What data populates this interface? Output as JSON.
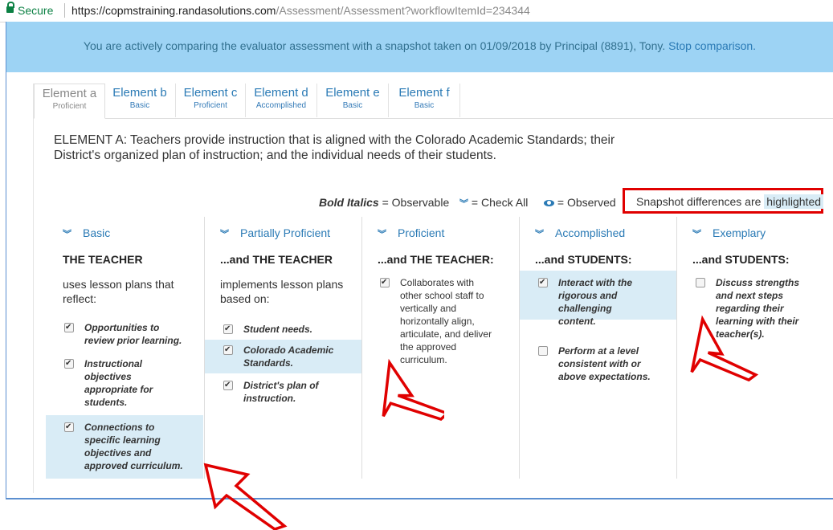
{
  "browser": {
    "secure_label": "Secure",
    "url_host": "https://copmstraining.randasolutions.com",
    "url_path": "/Assessment/Assessment?workflowItemId=234344"
  },
  "banner": {
    "text": "You are actively comparing the evaluator assessment with a snapshot taken on 01/09/2018 by Principal (8891), Tony.",
    "link": "Stop comparison."
  },
  "tabs": [
    {
      "label": "Element a",
      "rating": "Proficient"
    },
    {
      "label": "Element b",
      "rating": "Basic"
    },
    {
      "label": "Element c",
      "rating": "Proficient"
    },
    {
      "label": "Element d",
      "rating": "Accomplished"
    },
    {
      "label": "Element e",
      "rating": "Basic"
    },
    {
      "label": "Element f",
      "rating": "Basic"
    }
  ],
  "description": "ELEMENT A: Teachers provide instruction that is aligned with the Colorado Academic Standards; their District's organized plan of instruction; and the individual needs of their students.",
  "legend": {
    "bold_italics": "Bold Italics",
    "observable": "= Observable",
    "check_all_icon": "chevron-double-down-icon",
    "check_all": "= Check All",
    "observed_icon": "eye-icon",
    "observed": "= Observed",
    "snapshot_prefix": "Snapshot differences are",
    "snapshot_highlight": "highlighted"
  },
  "colors": {
    "banner_bg": "#9dd3f4",
    "highlight_bg": "#d9ecf6",
    "link": "#2a7ab5",
    "annotation_red": "#e00000"
  },
  "columns": [
    {
      "heading": "Basic",
      "subheading": "THE TEACHER",
      "intro": "uses lesson plans that reflect:",
      "items": [
        {
          "text": "Opportunities to review prior learning.",
          "checked": true,
          "observable": true,
          "highlighted": false
        },
        {
          "text": "Instructional objectives appropriate for students.",
          "checked": true,
          "observable": true,
          "highlighted": false
        },
        {
          "text": "Connections to specific learning objectives and approved curriculum.",
          "checked": true,
          "observable": true,
          "highlighted": true
        }
      ]
    },
    {
      "heading": "Partially Proficient",
      "subheading": "...and THE TEACHER",
      "intro": "implements lesson plans based on:",
      "items": [
        {
          "text": "Student needs.",
          "checked": true,
          "observable": true,
          "highlighted": false
        },
        {
          "text": "Colorado Academic Standards.",
          "checked": true,
          "observable": true,
          "highlighted": true
        },
        {
          "text": "District's plan of instruction.",
          "checked": true,
          "observable": true,
          "highlighted": false
        }
      ]
    },
    {
      "heading": "Proficient",
      "subheading": "...and THE TEACHER:",
      "intro": "",
      "items": [
        {
          "text": "Collaborates with other school staff to vertically and horizontally align, articulate, and deliver the approved curriculum.",
          "checked": true,
          "observable": false,
          "highlighted": false
        }
      ]
    },
    {
      "heading": "Accomplished",
      "subheading": "...and STUDENTS:",
      "intro": "",
      "items": [
        {
          "text": "Interact with the rigorous and challenging content.",
          "checked": true,
          "observable": true,
          "highlighted": true
        },
        {
          "text": "Perform at a level consistent with or above expectations.",
          "checked": false,
          "observable": true,
          "highlighted": false
        }
      ]
    },
    {
      "heading": "Exemplary",
      "subheading": "...and STUDENTS:",
      "intro": "",
      "items": [
        {
          "text": "Discuss strengths and next steps regarding their learning with their teacher(s).",
          "checked": false,
          "observable": true,
          "highlighted": false
        }
      ]
    }
  ]
}
